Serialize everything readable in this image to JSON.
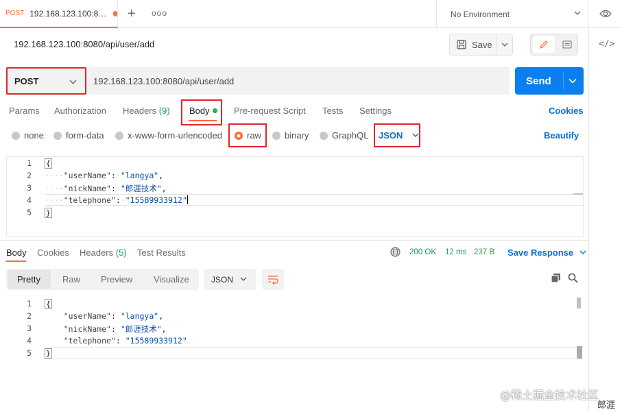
{
  "tab": {
    "method": "POST",
    "title": "192.168.123.100:8…"
  },
  "environment": {
    "label": "No Environment"
  },
  "request": {
    "title": "192.168.123.100:8080/api/user/add",
    "method": "POST",
    "url": "192.168.123.100:8080/api/user/add",
    "save_label": "Save",
    "send_label": "Send"
  },
  "request_tabs": {
    "params": "Params",
    "authorization": "Authorization",
    "headers": "Headers",
    "headers_count": "(9)",
    "body": "Body",
    "prerequest": "Pre-request Script",
    "tests": "Tests",
    "settings": "Settings",
    "cookies": "Cookies"
  },
  "body_types": {
    "none": "none",
    "form_data": "form-data",
    "urlencoded": "x-www-form-urlencoded",
    "raw": "raw",
    "binary": "binary",
    "graphql": "GraphQL",
    "language": "JSON",
    "beautify": "Beautify"
  },
  "request_body": {
    "line_numbers": [
      "1",
      "2",
      "3",
      "4",
      "5"
    ],
    "open": "{",
    "close": "}",
    "k1": "\"userName\"",
    "v1": "\"langya\"",
    "k2": "\"nickName\"",
    "v2": "\"郎涯技术\"",
    "k3": "\"telephone\"",
    "v3": "\"15589933912\""
  },
  "response_tabs": {
    "body": "Body",
    "cookies": "Cookies",
    "headers": "Headers",
    "headers_count": "(5)",
    "test_results": "Test Results"
  },
  "response_status": {
    "status": "200 OK",
    "time": "12 ms",
    "size": "237 B",
    "save_response": "Save Response"
  },
  "response_view": {
    "pretty": "Pretty",
    "raw": "Raw",
    "preview": "Preview",
    "visualize": "Visualize",
    "format": "JSON"
  },
  "response_body": {
    "line_numbers": [
      "1",
      "2",
      "3",
      "4",
      "5"
    ],
    "open": "{",
    "close": "}",
    "k1": "\"userName\"",
    "v1": "\"langya\"",
    "k2": "\"nickName\"",
    "v2": "\"郎涯技术\"",
    "k3": "\"telephone\"",
    "v3": "\"15589933912\""
  },
  "watermark": {
    "text": "@稀土掘金技术社区",
    "author": "郎涯"
  },
  "colors": {
    "accent": "#ff6c37",
    "send": "#0c7ff0",
    "highlight_box": "#e0252d",
    "link": "#0c6fd1",
    "ok": "#1f9d55"
  }
}
